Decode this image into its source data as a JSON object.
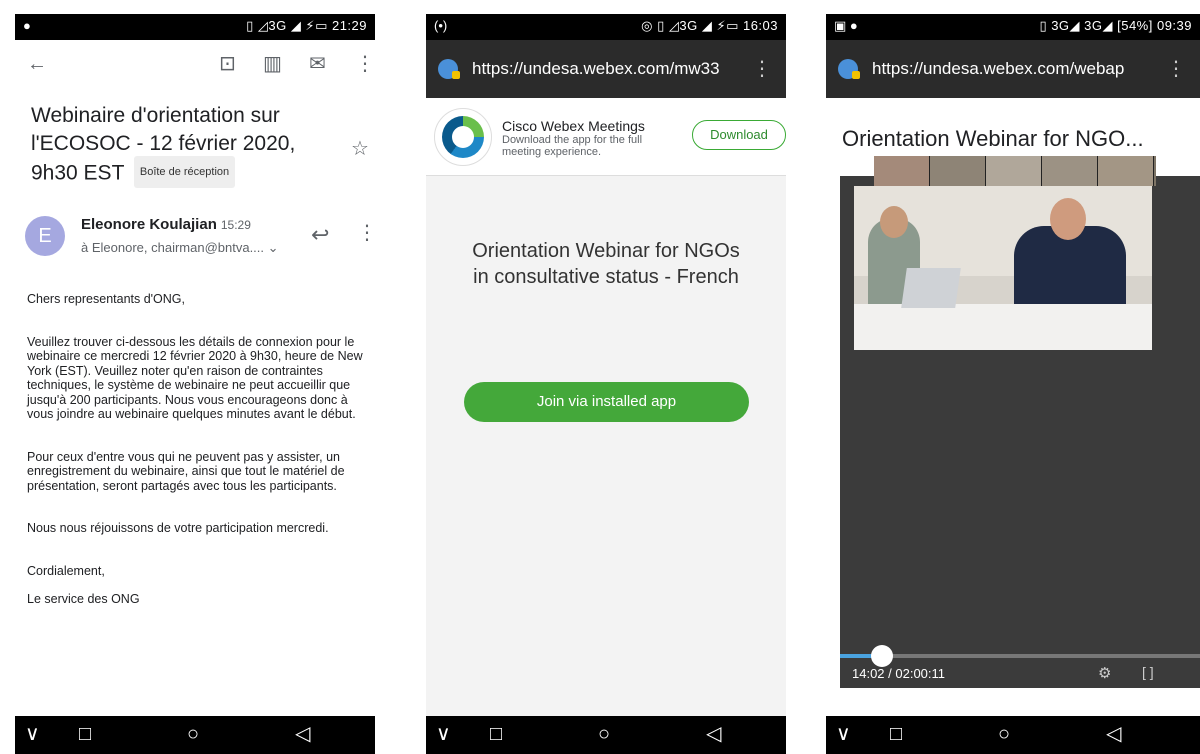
{
  "email": {
    "status": {
      "left": "●",
      "right": "▯ ◿3G ◢ ⚡▭ 21:29"
    },
    "subject": "Webinaire d'orientation sur l'ECOSOC - 12 février 2020, 9h30 EST",
    "inbox_label": "Boîte de réception",
    "sender": "Eleonore Koulajian",
    "time": "15:29",
    "avatar_letter": "E",
    "recipients": "à Eleonore, chairman@bntva....",
    "body": [
      "Chers representants d'ONG,",
      "Veuillez trouver ci-dessous les détails de connexion pour le webinaire ce mercredi 12 février 2020 à 9h30, heure de New York (EST). Veuillez noter qu'en raison de contraintes techniques, le système de webinaire ne peut accueillir que jusqu'à 200 participants. Nous vous encourageons donc à vous joindre au webinaire quelques minutes avant le début.",
      "Pour ceux d'entre vous qui ne peuvent pas y assister, un enregistrement du webinaire, ainsi que tout le matériel de présentation, seront partagés avec tous les participants.",
      "Nous nous réjouissons de votre participation mercredi.",
      "Cordialement,",
      "Le service des ONG"
    ],
    "icons": {
      "back": "←",
      "archive": "⊡",
      "delete": "▥",
      "mail": "✉",
      "more": "⋮",
      "star": "☆",
      "reply": "↩"
    }
  },
  "webex": {
    "status": {
      "left": "(•)",
      "right": "◎ ▯ ◿3G ◢ ⚡▭ 16:03"
    },
    "url": "https://undesa.webex.com/mw33",
    "app_name": "Cisco Webex Meetings",
    "app_desc": "Download the app for the full meeting experience.",
    "download_label": "Download",
    "meeting_title": "Orientation Webinar for NGOs in consultative status - French",
    "join_label": "Join via installed app"
  },
  "recording": {
    "status": {
      "left": "▣ ●",
      "right": "▯ 3G◢ 3G◢ [54%] 09:39"
    },
    "url": "https://undesa.webex.com/webap",
    "title": "Orientation Webinar for NGO...",
    "timecode": "14:02 / 02:00:11",
    "progress": 0.117
  },
  "navbar": {
    "down": "∨",
    "recent": "□",
    "home": "○",
    "back": "◁"
  },
  "colors": {
    "accent_green": "#44a83a",
    "seek_blue": "#4aa3e0",
    "dark_bar": "#2b2b2b"
  }
}
